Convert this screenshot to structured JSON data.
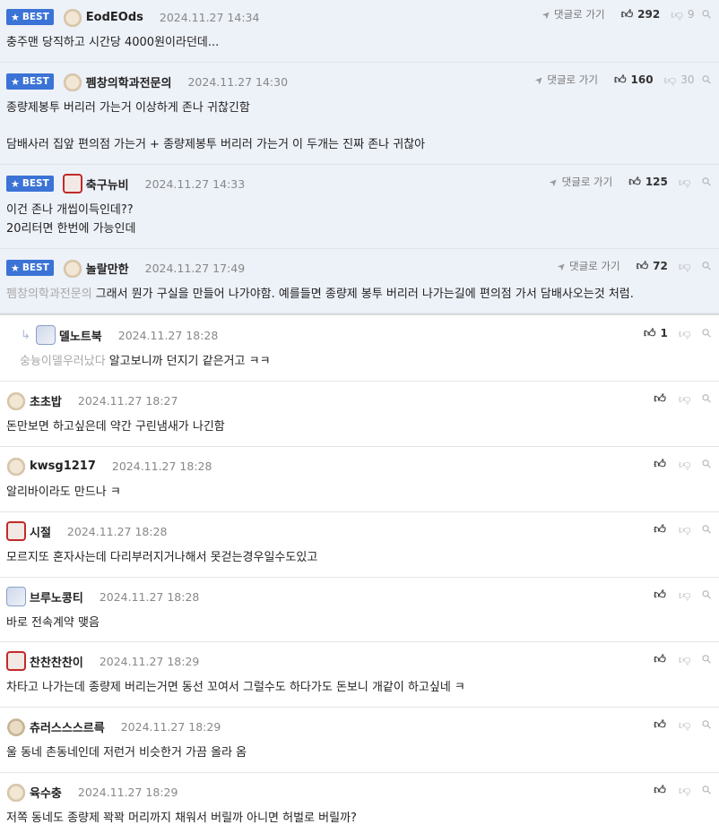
{
  "ui": {
    "best_label": "BEST",
    "goto_label": "댓글로 가기"
  },
  "best_comments": [
    {
      "nickname": "EodEOds",
      "date": "2024.11.27 14:34",
      "likes": "292",
      "dislikes": "9",
      "lines": [
        "충주맨 당직하고 시간당 4000원이라던데..."
      ]
    },
    {
      "nickname": "펨창의학과전문의",
      "date": "2024.11.27 14:30",
      "likes": "160",
      "dislikes": "30",
      "lines": [
        "종량제봉투 버리러 가는거 이상하게 존나 귀찮긴함",
        "담배사러 집앞 편의점 가는거 + 종량제봉투 버리러 가는거 이 두개는 진짜 존나 귀찮아"
      ]
    },
    {
      "nickname": "축구뉴비",
      "date": "2024.11.27 14:33",
      "likes": "125",
      "lines": [
        "이건 존나 개씹이득인데??",
        "20리터면 한번에 가능인데"
      ]
    },
    {
      "nickname": "놀랄만한",
      "date": "2024.11.27 17:49",
      "likes": "72",
      "mention": "펨창의학과전문의",
      "lines": [
        "그래서 뭔가 구실을 만들어 나가야함. 예를들면 종량제 봉투 버리러 나가는길에 편의점 가서 담배사오는것 처럼."
      ]
    }
  ],
  "reply": {
    "nickname": "델노트북",
    "date": "2024.11.27 18:28",
    "likes": "1",
    "mention": "숭늉이델우러났다",
    "text": "알고보니까 던지기 같은거고 ㅋㅋ"
  },
  "comments": [
    {
      "nickname": "초초밥",
      "date": "2024.11.27 18:27",
      "text": "돈만보면 하고싶은데 약간 구린냄새가 나긴함"
    },
    {
      "nickname": "kwsg1217",
      "date": "2024.11.27 18:28",
      "text": "알리바이라도 만드나 ㅋ"
    },
    {
      "nickname": "시절",
      "date": "2024.11.27 18:28",
      "text": "모르지또 혼자사는데 다리부러지거나해서 못걷는경우일수도있고"
    },
    {
      "nickname": "브루노콩티",
      "date": "2024.11.27 18:28",
      "text": "바로 전속계약 맺음"
    },
    {
      "nickname": "찬찬찬찬이",
      "date": "2024.11.27 18:29",
      "text": "차타고 나가는데 종량제 버리는거면 동선 꼬여서 그럴수도 하다가도 돈보니 개같이 하고싶네 ㅋ"
    },
    {
      "nickname": "츄러스스스르륵",
      "date": "2024.11.27 18:29",
      "text": "울 동네 촌동네인데 저런거 비슷한거 가끔 올라 옴"
    },
    {
      "nickname": "육수충",
      "date": "2024.11.27 18:29",
      "text": "저쪽 동네도 종량제 꽉꽉 머리까지 채워서 버릴까 아니면 허벌로 버릴까?"
    }
  ]
}
